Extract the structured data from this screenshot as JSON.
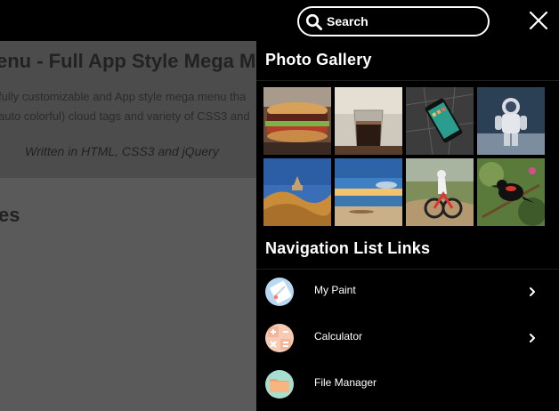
{
  "background_page": {
    "title": "enu - Full App Style Mega M",
    "description_line1": "fully customizable and App style mega menu tha",
    "description_line2": "auto colorful) cloud tags and variety of CSS3 and",
    "written_in": "Written in HTML, CSS3 and jQuery",
    "section_heading": "es"
  },
  "search": {
    "placeholder": "Search"
  },
  "menu": {
    "gallery_title": "Photo Gallery",
    "gallery_images": [
      {
        "name": "sandwich-photo"
      },
      {
        "name": "glass-of-coffee-photo"
      },
      {
        "name": "smartphone-on-map-photo"
      },
      {
        "name": "astronaut-photo"
      },
      {
        "name": "desert-dunes-photo"
      },
      {
        "name": "beach-sunset-photo"
      },
      {
        "name": "mountain-biker-photo"
      },
      {
        "name": "red-winged-blackbird-photo"
      }
    ],
    "nav_title": "Navigation List Links",
    "nav_items": [
      {
        "label": "My Paint",
        "icon": "paint-icon",
        "has_submenu": true
      },
      {
        "label": "Calculator",
        "icon": "calculator-icon",
        "has_submenu": true
      },
      {
        "label": "File Manager",
        "icon": "file-manager-icon",
        "has_submenu": false
      }
    ]
  },
  "colors": {
    "panel_bg": "#000000",
    "overlay_bg": "#5a5a5a",
    "paint_icon_bg": "#b9d9f3",
    "calculator_icon_bg": "#f6cbb4",
    "file_manager_icon_bg": "#a8ded0"
  }
}
